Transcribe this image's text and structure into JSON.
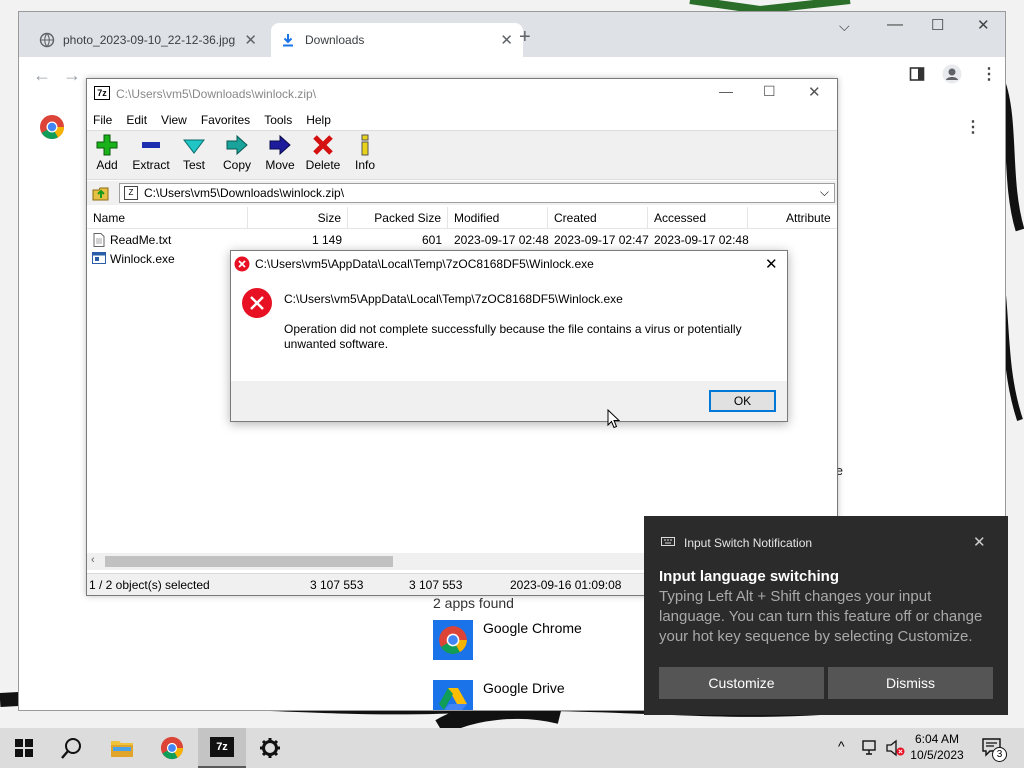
{
  "chrome": {
    "tabs": [
      {
        "title": "photo_2023-09-10_22-12-36.jpg"
      },
      {
        "title": "Downloads"
      }
    ],
    "downloads": {
      "results_text": "2 apps found",
      "items": [
        {
          "name": "Google Chrome"
        },
        {
          "name": "Google Drive"
        }
      ],
      "partial_text": "ove"
    }
  },
  "zip": {
    "title": "C:\\Users\\vm5\\Downloads\\winlock.zip\\",
    "menu": [
      "File",
      "Edit",
      "View",
      "Favorites",
      "Tools",
      "Help"
    ],
    "toolbar": [
      "Add",
      "Extract",
      "Test",
      "Copy",
      "Move",
      "Delete",
      "Info"
    ],
    "address": "C:\\Users\\vm5\\Downloads\\winlock.zip\\",
    "columns": [
      "Name",
      "Size",
      "Packed Size",
      "Modified",
      "Created",
      "Accessed",
      "Attribute"
    ],
    "files": [
      {
        "name": "ReadMe.txt",
        "size": "1 149",
        "packed": "601",
        "modified": "2023-09-17 02:48",
        "created": "2023-09-17 02:47",
        "accessed": "2023-09-17 02:48"
      },
      {
        "name": "Winlock.exe",
        "size": "",
        "packed": "",
        "modified": "",
        "created": "",
        "accessed": ""
      }
    ],
    "status": {
      "selected": "1 / 2 object(s) selected",
      "size": "3 107 553",
      "packed": "3 107 553",
      "modified": "2023-09-16 01:09:08"
    }
  },
  "dialog": {
    "title": "C:\\Users\\vm5\\AppData\\Local\\Temp\\7zOC8168DF5\\Winlock.exe",
    "path": "C:\\Users\\vm5\\AppData\\Local\\Temp\\7zOC8168DF5\\Winlock.exe",
    "message": "Operation did not complete successfully because the file contains a virus or potentially unwanted software.",
    "ok": "OK"
  },
  "toast": {
    "app": "Input Switch Notification",
    "heading": "Input language switching",
    "body": "Typing Left Alt + Shift changes your input language. You can turn this feature off or change your hot key sequence by selecting Customize.",
    "customize": "Customize",
    "dismiss": "Dismiss"
  },
  "taskbar": {
    "time": "6:04 AM",
    "date": "10/5/2023",
    "notification_count": "3"
  },
  "colors": {
    "error_red": "#e81123",
    "toast_bg": "#2b2b2b",
    "chrome_tabstrip": "#dee1e6",
    "accent_blue": "#0078d7"
  }
}
